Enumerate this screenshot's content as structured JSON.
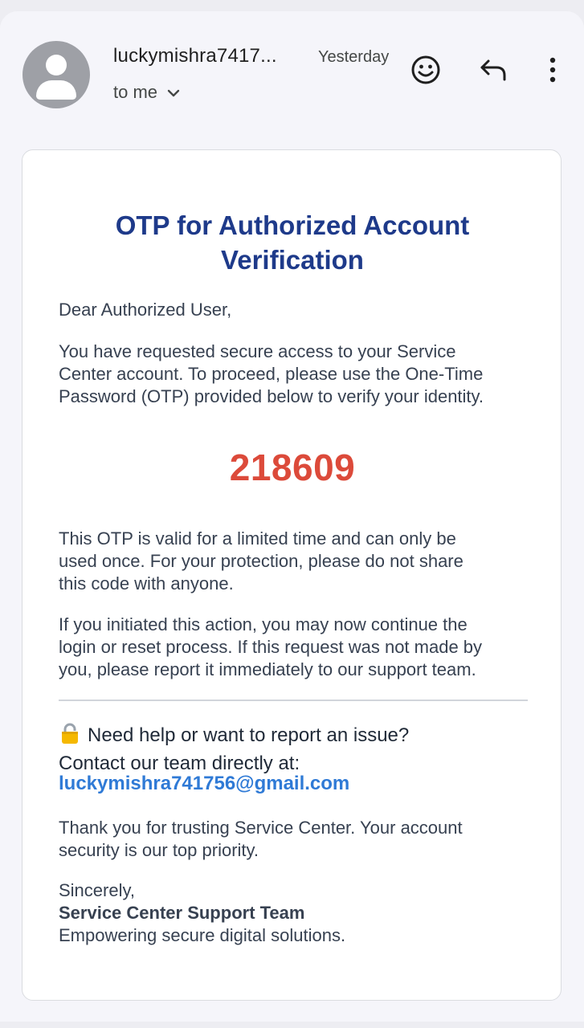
{
  "header": {
    "sender": "luckymishra7417...",
    "date": "Yesterday",
    "recipient": "to me",
    "icons": [
      "avatar-icon",
      "emoji-icon",
      "reply-icon",
      "more-vert-icon",
      "chevron-down-icon"
    ]
  },
  "email": {
    "title_line1": "OTP for Authorized Account",
    "title_line2": "Verification",
    "greeting": "Dear Authorized User,",
    "intro_line1": "You have requested secure access to your Service",
    "intro_line2": "Center account. To proceed, please use the One-Time",
    "intro_line3": "Password (OTP) provided below to verify your identity.",
    "otp": "218609",
    "validity_line1": "This OTP is valid for a limited time and can only be",
    "validity_line2": "used once. For your protection, please do not share",
    "validity_line3": "this code with anyone.",
    "initiated_line1": "If you initiated this action, you may now continue the",
    "initiated_line2": "login or reset process. If this request was not made by",
    "initiated_line3": "you, please report it immediately to our support team.",
    "help_line1": "Need help or want to report an issue?",
    "help_line2": "Contact our team directly at:",
    "contact_email": "luckymishra741756@gmail.com",
    "thanks_line1": "Thank you for trusting Service Center. Your account",
    "thanks_line2": "security is our top priority.",
    "signoff": "Sincerely,",
    "team": "Service Center Support Team",
    "tagline": "Empowering secure digital solutions."
  },
  "colors": {
    "title": "#1e3a8a",
    "otp": "#dc4a3a",
    "link": "#2f7ad6",
    "body_text": "#374151"
  }
}
